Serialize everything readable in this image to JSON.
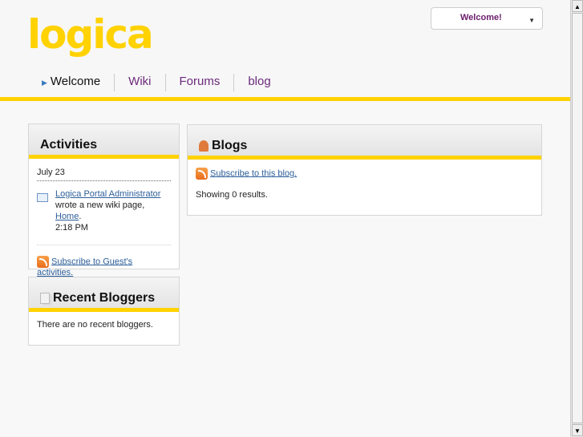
{
  "logo": "logica",
  "user_menu": {
    "label": "Welcome!"
  },
  "nav": [
    {
      "label": "Welcome",
      "active": true
    },
    {
      "label": "Wiki"
    },
    {
      "label": "Forums"
    },
    {
      "label": "blog"
    }
  ],
  "activities": {
    "title": "Activities",
    "date": "July 23",
    "entry": {
      "user": "Logica Portal Administrator",
      "text": "wrote a new wiki page,",
      "page": "Home",
      "time": "2:18 PM"
    },
    "subscribe": "Subscribe to Guest's activities."
  },
  "recent_bloggers": {
    "title": "Recent Bloggers",
    "empty": "There are no recent bloggers."
  },
  "blogs": {
    "title": "Blogs",
    "subscribe": "Subscribe to this blog.",
    "results": "Showing 0 results."
  },
  "colors": {
    "accent": "#ffd200",
    "nav_link": "#6b2a7b",
    "link": "#2d5f9a"
  }
}
